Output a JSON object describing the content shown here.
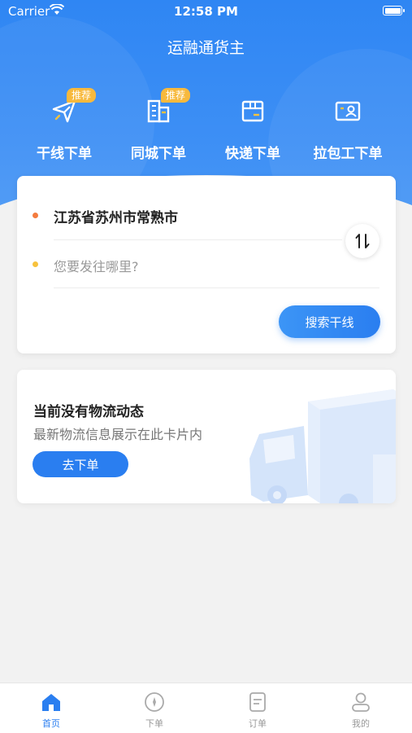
{
  "status_bar": {
    "carrier": "Carrier",
    "time": "12:58 PM"
  },
  "header": {
    "title": "运融通货主"
  },
  "shortcuts": [
    {
      "label": "干线下单",
      "badge": "推荐",
      "icon": "paper-plane-icon"
    },
    {
      "label": "同城下单",
      "badge": "推荐",
      "icon": "building-icon"
    },
    {
      "label": "快递下单",
      "badge": "",
      "icon": "parcel-box-icon"
    },
    {
      "label": "拉包工下单",
      "badge": "",
      "icon": "id-card-icon"
    }
  ],
  "route": {
    "from": "江苏省苏州市常熟市",
    "to_placeholder": "您要发往哪里?",
    "search_button": "搜索干线"
  },
  "logistics": {
    "title": "当前没有物流动态",
    "subtitle": "最新物流信息展示在此卡片内",
    "order_button": "去下单"
  },
  "tabbar": [
    {
      "label": "首页",
      "icon": "home-icon",
      "active": true
    },
    {
      "label": "下单",
      "icon": "compass-icon",
      "active": false
    },
    {
      "label": "订单",
      "icon": "document-icon",
      "active": false
    },
    {
      "label": "我的",
      "icon": "user-icon",
      "active": false
    }
  ],
  "colors": {
    "primary": "#2a7ef0",
    "badge": "#f7b93d",
    "from_dot": "#f47b3e",
    "to_dot": "#f7c23d"
  }
}
